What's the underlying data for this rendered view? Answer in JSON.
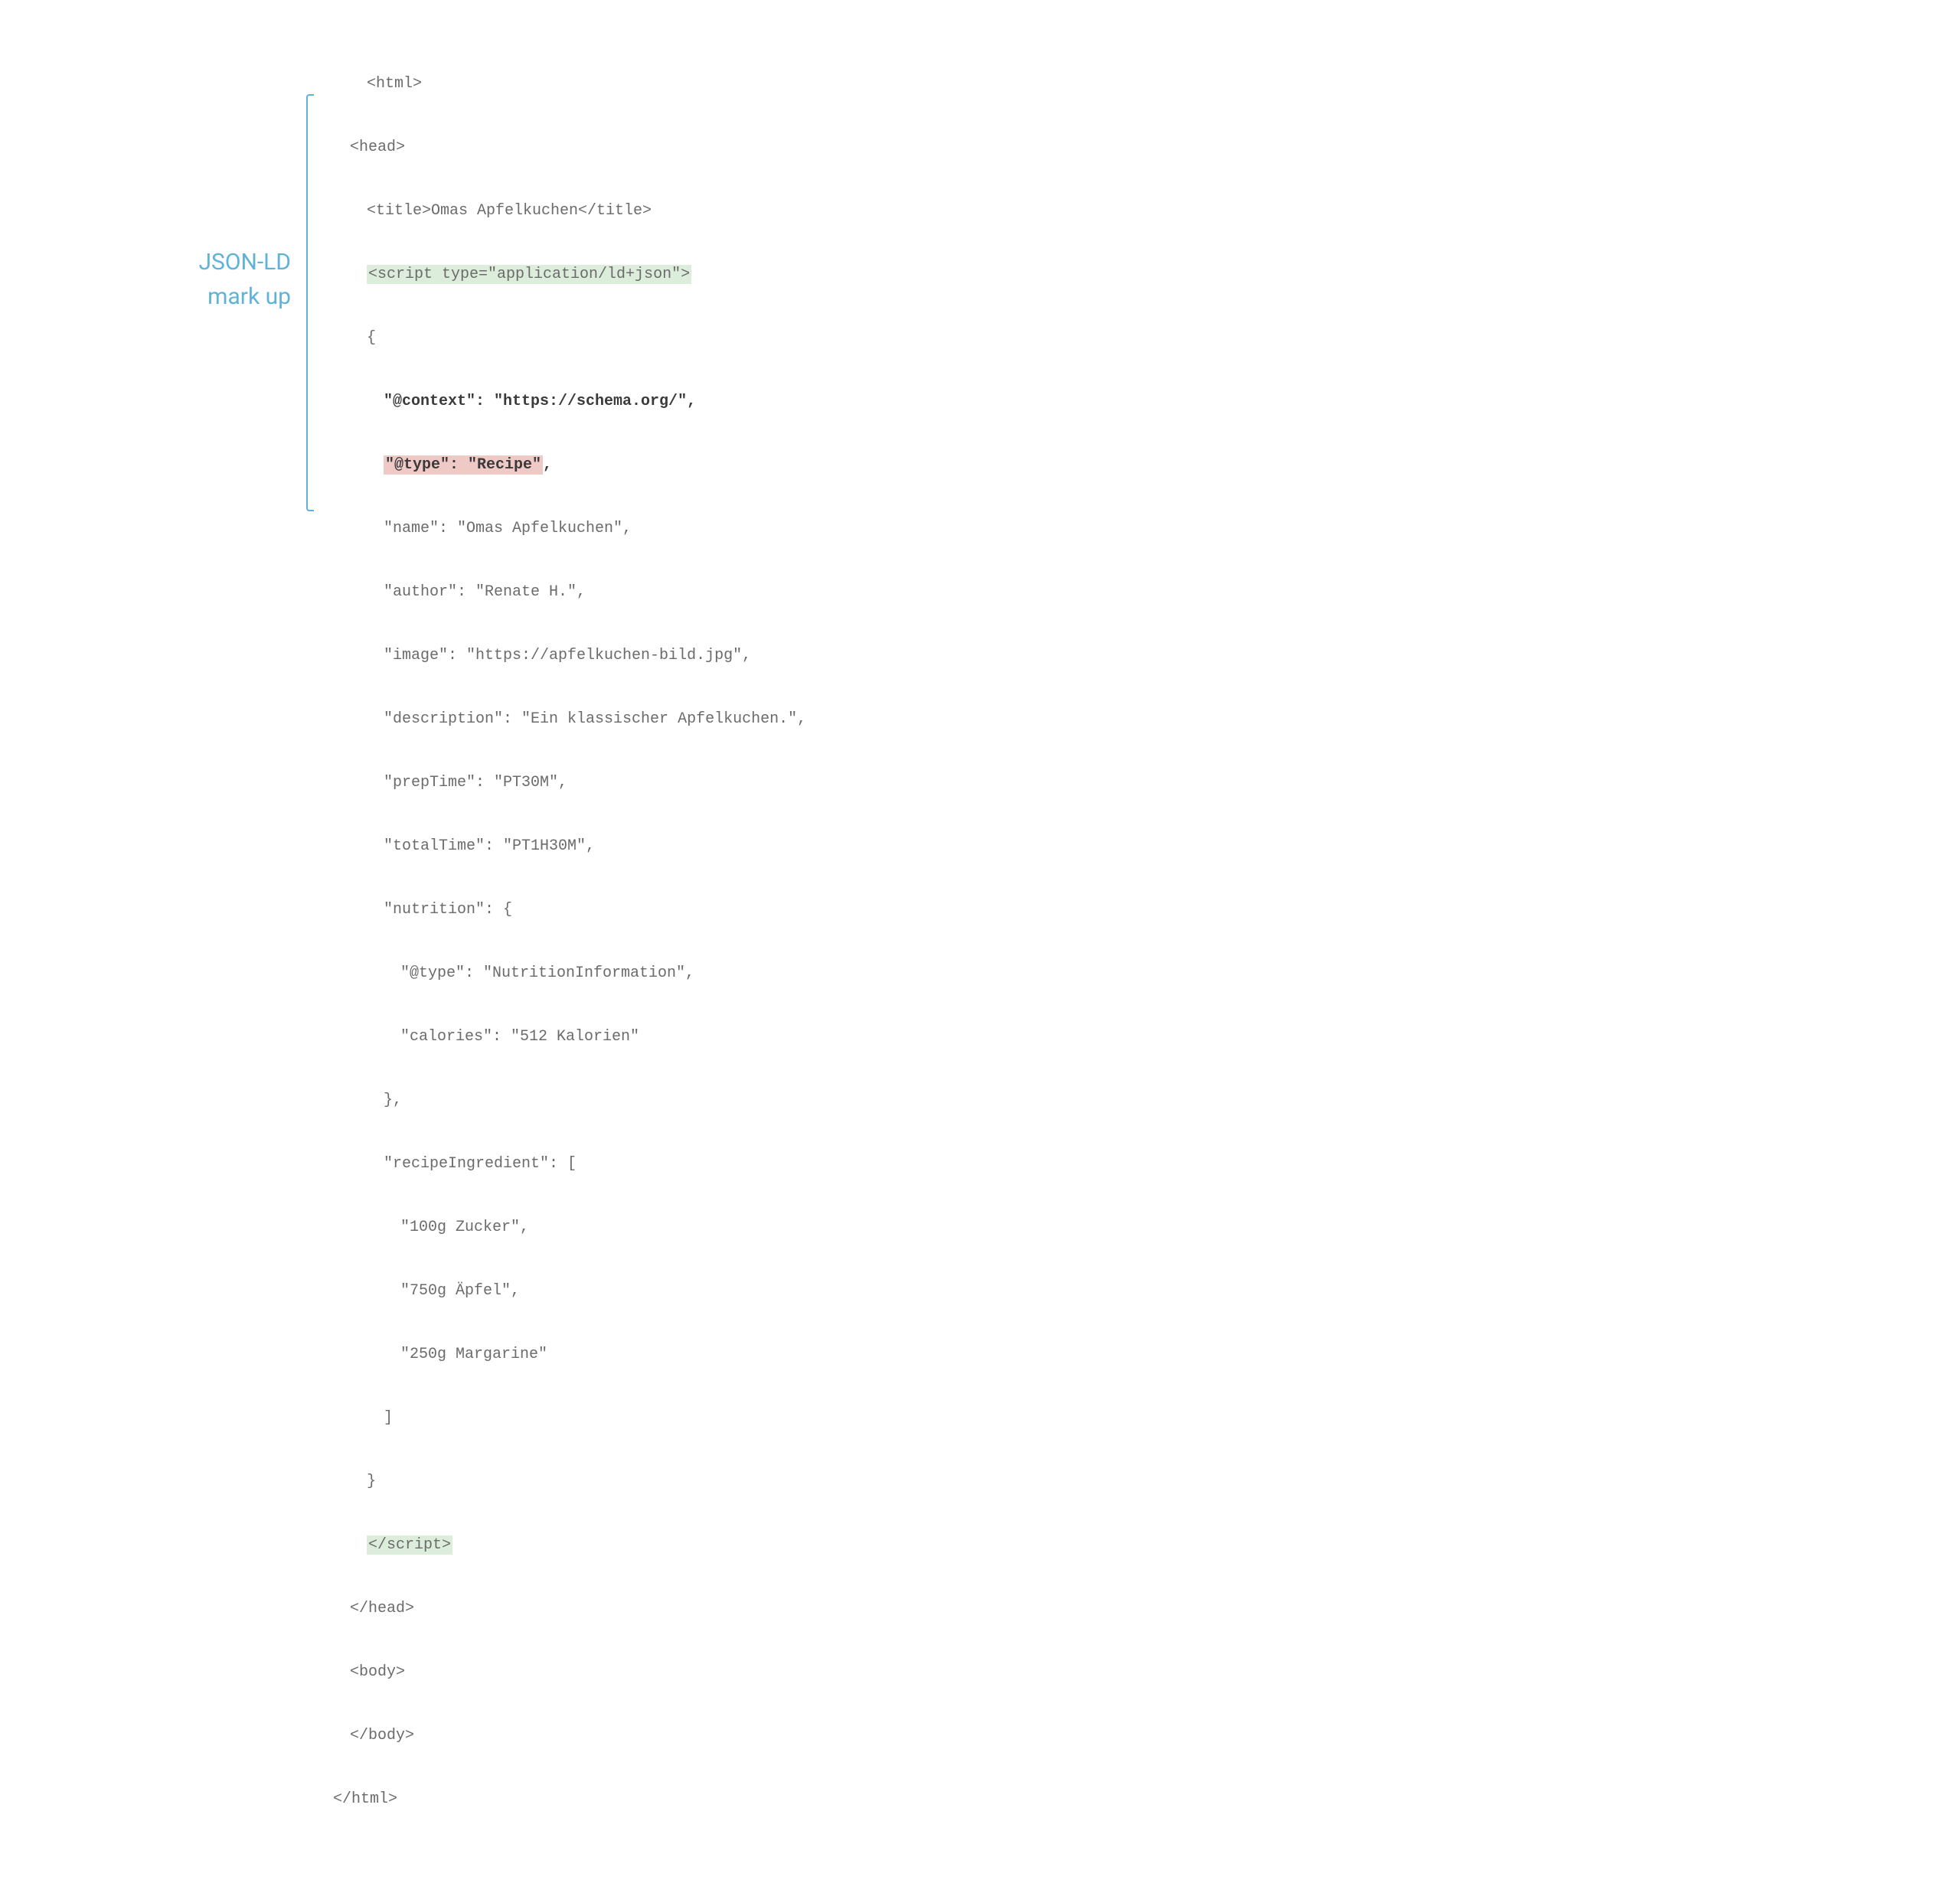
{
  "annotation": {
    "label_line1": "JSON-LD",
    "label_line2": "mark up"
  },
  "code": {
    "line01": "<html>",
    "line02": "<head>",
    "line03_open": "<title>",
    "line03_text": "Omas Apfelkuchen",
    "line03_close": "</title>",
    "line04_open": "<script",
    "line04_attr": " type=\"application/ld+json\">",
    "line05": "{",
    "line06": "\"@context\": \"https://schema.org/\",",
    "line07_hl": "\"@type\": \"Recipe\"",
    "line07_comma": ",",
    "line08": "\"name\": \"Omas Apfelkuchen\",",
    "line09": "\"author\": \"Renate H.\",",
    "line10": "\"image\": \"https://apfelkuchen-bild.jpg\",",
    "line11": "\"description\": \"Ein klassischer Apfelkuchen.\",",
    "line12": "\"prepTime\": \"PT30M\",",
    "line13": "\"totalTime\": \"PT1H30M\",",
    "line14": "\"nutrition\": {",
    "line15": "\"@type\": \"NutritionInformation\",",
    "line16": "\"calories\": \"512 Kalorien\"",
    "line17": "},",
    "line18": "\"recipeIngredient\": [",
    "line19": "\"100g Zucker\",",
    "line20": "\"750g Äpfel\",",
    "line21": "\"250g Margarine\"",
    "line22": "]",
    "line23": "}",
    "line24_close": "</scr",
    "line24_close2": "ipt>",
    "line25": "</head>",
    "line26": "<body>",
    "line27": "</body>",
    "line28": "</html>"
  }
}
